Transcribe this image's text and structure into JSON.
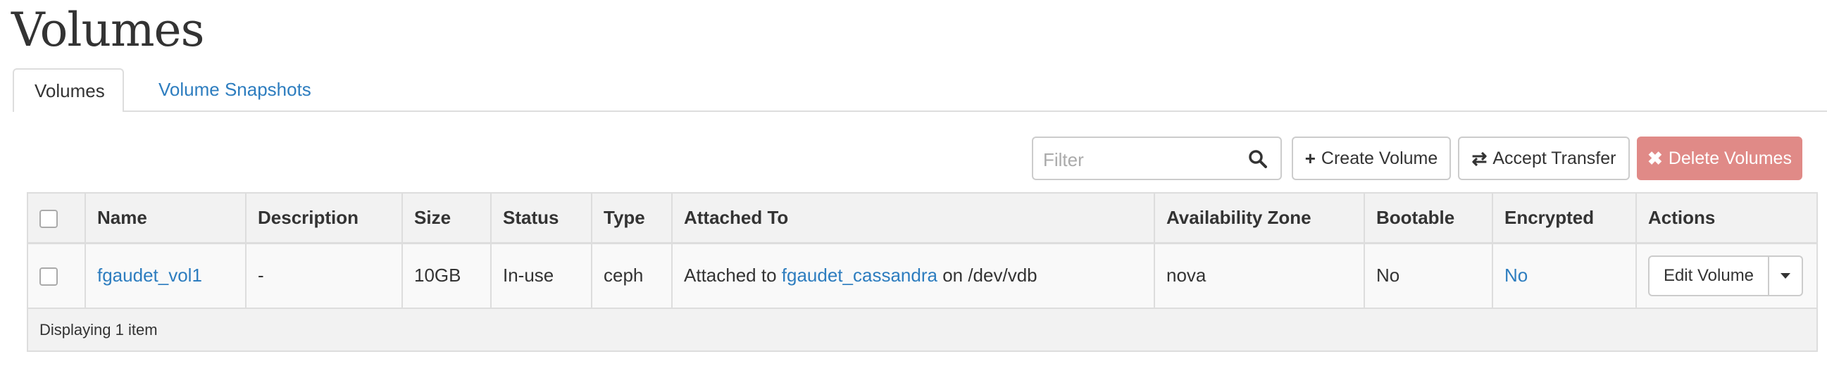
{
  "page": {
    "title": "Volumes"
  },
  "tabs": [
    {
      "label": "Volumes",
      "active": true
    },
    {
      "label": "Volume Snapshots",
      "active": false
    }
  ],
  "toolbar": {
    "filter_placeholder": "Filter",
    "create_label": "Create Volume",
    "accept_label": "Accept Transfer",
    "delete_label": "Delete Volumes",
    "create_icon": "plus-icon",
    "accept_icon": "transfer-arrows-icon",
    "delete_icon": "x-icon",
    "delete_color": "#e08a87"
  },
  "table": {
    "columns": [
      "Name",
      "Description",
      "Size",
      "Status",
      "Type",
      "Attached To",
      "Availability Zone",
      "Bootable",
      "Encrypted",
      "Actions"
    ],
    "rows": [
      {
        "name": "fgaudet_vol1",
        "description": "-",
        "size": "10GB",
        "status": "In-use",
        "type": "ceph",
        "attached_prefix": "Attached to",
        "attached_instance": "fgaudet_cassandra",
        "attached_suffix": "on /dev/vdb",
        "availability_zone": "nova",
        "bootable": "No",
        "encrypted": "No",
        "action_label": "Edit Volume"
      }
    ],
    "footer": "Displaying 1 item"
  },
  "colors": {
    "link": "#2d7dbf",
    "header_bg": "#f2f2f2",
    "row_bg": "#f9f9f9"
  }
}
